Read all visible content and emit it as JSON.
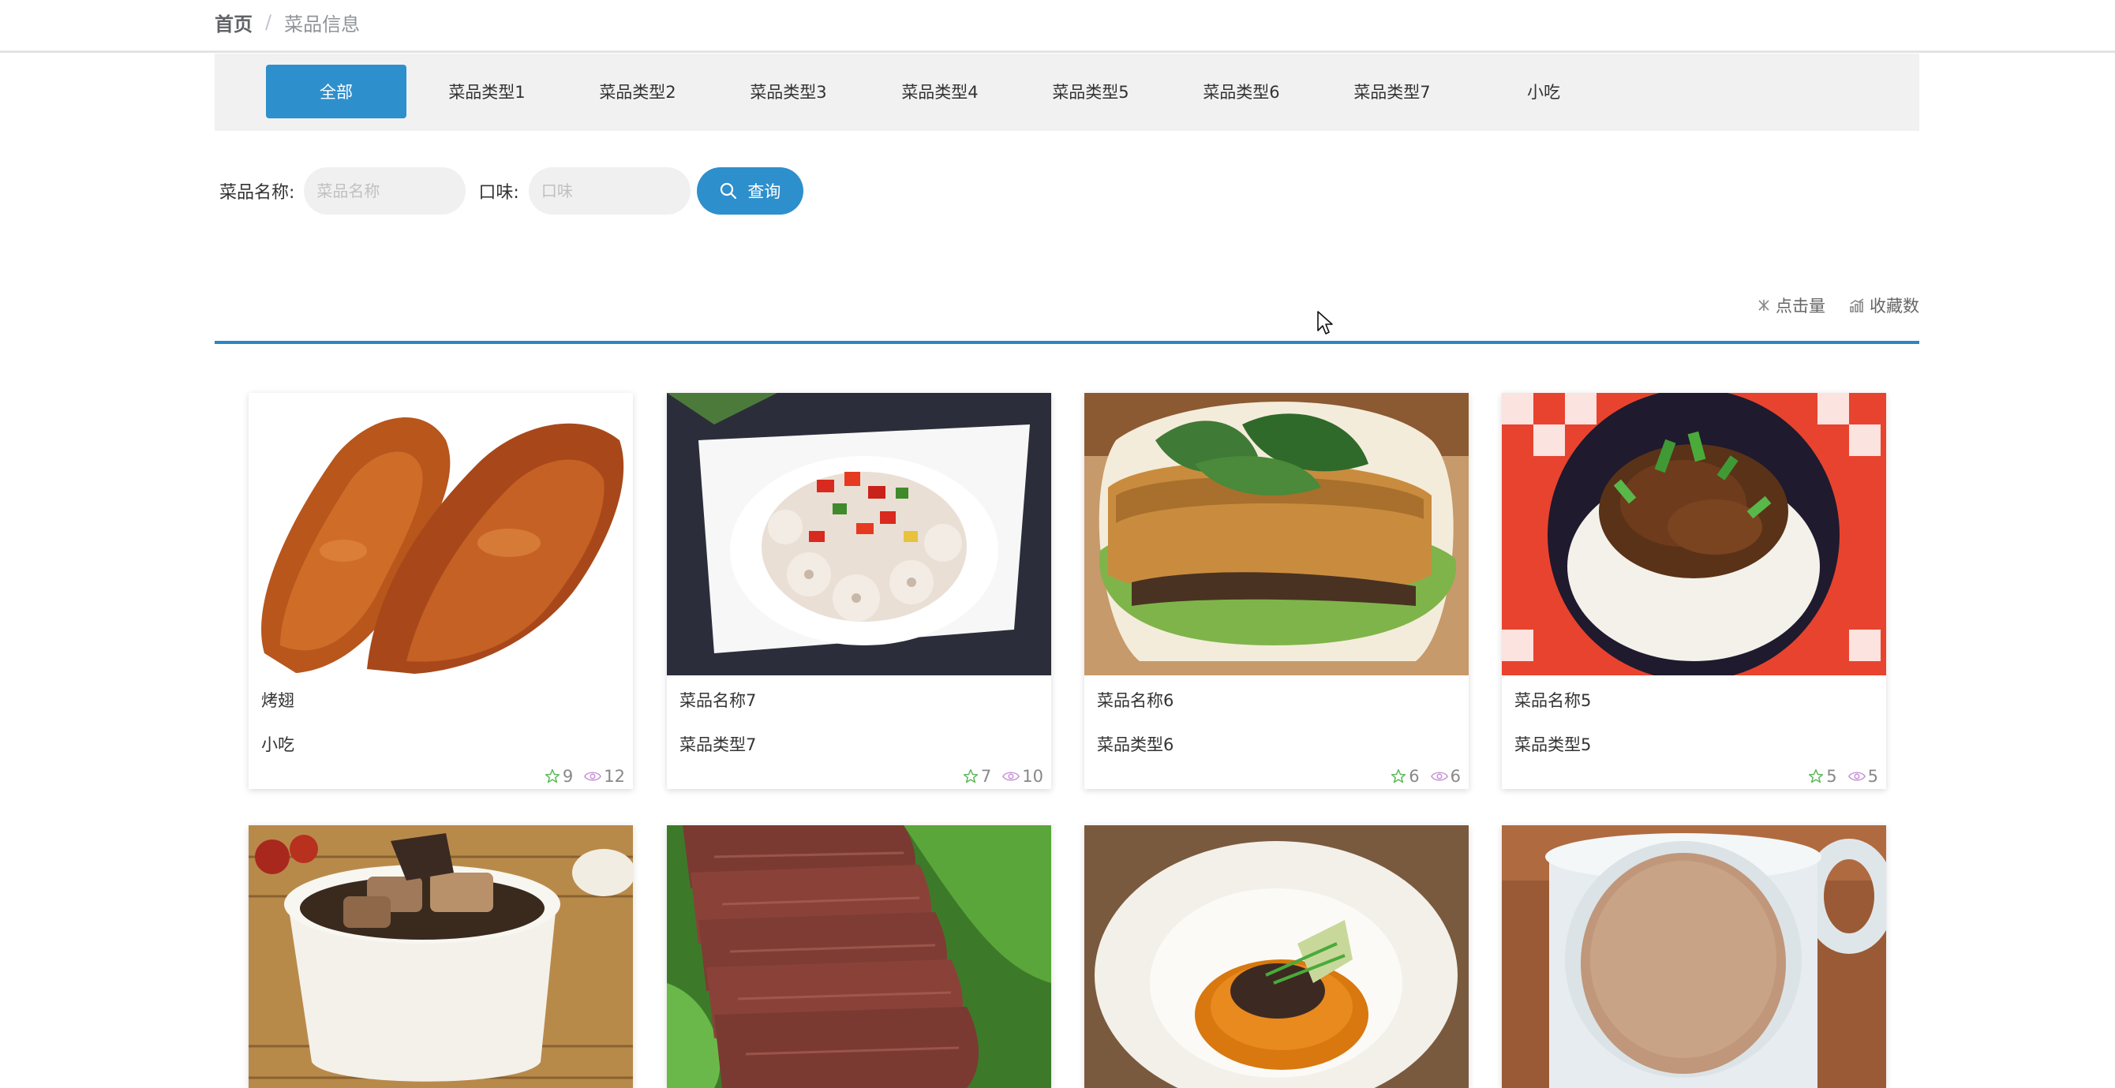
{
  "breadcrumb": {
    "home": "首页",
    "separator": "/",
    "current": "菜品信息"
  },
  "categories": [
    {
      "label": "全部",
      "active": true
    },
    {
      "label": "菜品类型1"
    },
    {
      "label": "菜品类型2"
    },
    {
      "label": "菜品类型3"
    },
    {
      "label": "菜品类型4"
    },
    {
      "label": "菜品类型5"
    },
    {
      "label": "菜品类型6"
    },
    {
      "label": "菜品类型7"
    },
    {
      "label": "小吃"
    }
  ],
  "search": {
    "name_label": "菜品名称:",
    "name_placeholder": "菜品名称",
    "taste_label": "口味:",
    "taste_placeholder": "口味",
    "button_label": "查询"
  },
  "sort": {
    "clicks": "点击量",
    "favorites": "收藏数"
  },
  "colors": {
    "accent": "#2e8fcd",
    "rule": "#2b86c1"
  },
  "cards": [
    {
      "name": "烤翅",
      "type": "小吃",
      "stars": "9",
      "views": "12"
    },
    {
      "name": "菜品名称7",
      "type": "菜品类型7",
      "stars": "7",
      "views": "10"
    },
    {
      "name": "菜品名称6",
      "type": "菜品类型6",
      "stars": "6",
      "views": "6"
    },
    {
      "name": "菜品名称5",
      "type": "菜品类型5",
      "stars": "5",
      "views": "5"
    },
    {
      "name": "",
      "type": ""
    },
    {
      "name": "",
      "type": ""
    },
    {
      "name": "",
      "type": ""
    },
    {
      "name": "",
      "type": ""
    }
  ]
}
